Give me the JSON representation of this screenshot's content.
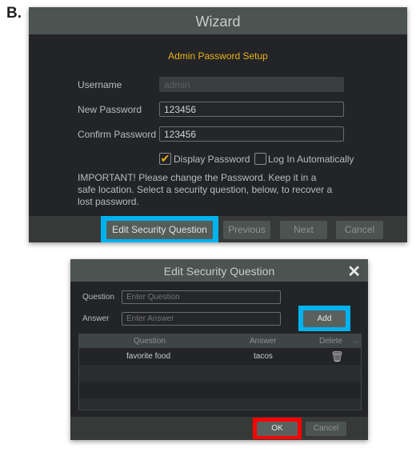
{
  "figure_label": "B.",
  "wizard": {
    "title": "Wizard",
    "subtitle": "Admin Password Setup",
    "username_label": "Username",
    "username_value": "admin",
    "new_password_label": "New Password",
    "new_password_value": "123456",
    "confirm_password_label": "Confirm Password",
    "confirm_password_value": "123456",
    "display_password_label": "Display Password",
    "display_password_checked": true,
    "auto_login_label": "Log In Automatically",
    "auto_login_checked": false,
    "notice": "IMPORTANT! Please change the Password. Keep it in a safe location. Select a security question, below, to recover a lost password.",
    "buttons": {
      "edit_security": "Edit Security Question",
      "previous": "Previous",
      "next": "Next",
      "cancel": "Cancel"
    }
  },
  "security_dialog": {
    "title": "Edit Security Question",
    "question_label": "Question",
    "question_placeholder": "Enter Question",
    "answer_label": "Answer",
    "answer_placeholder": "Enter Answer",
    "add": "Add",
    "columns": [
      "Question",
      "Answer",
      "Delete"
    ],
    "rows": [
      {
        "question": "favorite food",
        "answer": "tacos"
      }
    ],
    "ok": "OK",
    "cancel": "Cancel"
  },
  "colors": {
    "highlight_blue": "#00b2ee",
    "highlight_red": "#ff0000",
    "accent_yellow": "#e8b416"
  }
}
